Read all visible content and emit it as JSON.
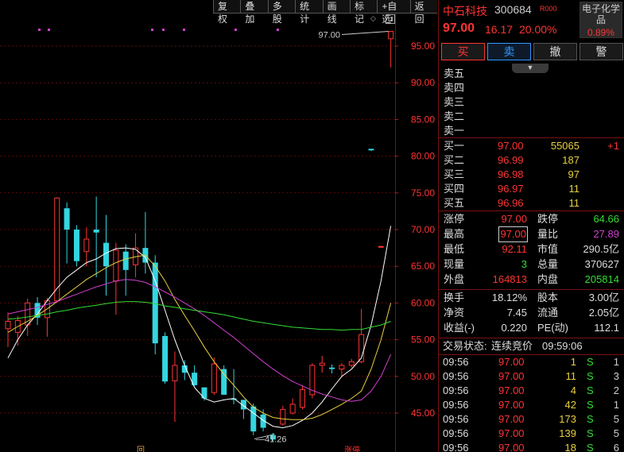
{
  "toolbar": [
    {
      "name": "fuquan-button",
      "label": "复权"
    },
    {
      "name": "overlay-button",
      "label": "叠加"
    },
    {
      "name": "multi-stock-button",
      "label": "多股"
    },
    {
      "name": "stats-button",
      "label": "统计"
    },
    {
      "name": "draw-line-button",
      "label": "画线"
    },
    {
      "name": "mark-button",
      "label": "标记"
    },
    {
      "name": "add-watchlist-button",
      "label": "+自选"
    },
    {
      "name": "back-button",
      "label": "返回"
    }
  ],
  "price_axis": [
    "95.00",
    "90.00",
    "85.00",
    "80.00",
    "75.00",
    "70.00",
    "65.00",
    "60.00",
    "55.00",
    "50.00",
    "45.00"
  ],
  "chart_data": {
    "type": "candlestick",
    "title": "",
    "ylim": [
      40.5,
      98.5
    ],
    "y_ticks": [
      95,
      90,
      85,
      80,
      75,
      70,
      65,
      60,
      55,
      50,
      45
    ],
    "annotations": {
      "high_label": "97.00",
      "low_label": "41.26",
      "bottom_left": "回",
      "bottom_right": "涨停"
    },
    "candles": [
      {
        "o": 56.5,
        "h": 58.7,
        "l": 54.0,
        "c": 57.5
      },
      {
        "o": 56.0,
        "h": 58.2,
        "l": 54.2,
        "c": 57.6
      },
      {
        "o": 57.0,
        "h": 60.6,
        "l": 55.5,
        "c": 60.0
      },
      {
        "o": 60.0,
        "h": 60.8,
        "l": 57.0,
        "c": 58.0
      },
      {
        "o": 58.0,
        "h": 60.7,
        "l": 55.4,
        "c": 60.3
      },
      {
        "o": 60.3,
        "h": 74.4,
        "l": 60.0,
        "c": 74.3
      },
      {
        "o": 72.9,
        "h": 73.7,
        "l": 65.4,
        "c": 70.0
      },
      {
        "o": 70.0,
        "h": 70.6,
        "l": 65.0,
        "c": 65.7
      },
      {
        "o": 67.0,
        "h": 70.3,
        "l": 65.0,
        "c": 68.7
      },
      {
        "o": 70.0,
        "h": 74.5,
        "l": 63.5,
        "c": 69.6
      },
      {
        "o": 68.2,
        "h": 72.0,
        "l": 61.0,
        "c": 65.0
      },
      {
        "o": 63.0,
        "h": 68.2,
        "l": 58.4,
        "c": 67.2
      },
      {
        "o": 67.0,
        "h": 68.0,
        "l": 61.0,
        "c": 64.5
      },
      {
        "o": 65.2,
        "h": 69.5,
        "l": 63.5,
        "c": 67.5
      },
      {
        "o": 67.5,
        "h": 72.4,
        "l": 64.0,
        "c": 65.5
      },
      {
        "o": 65.5,
        "h": 66.5,
        "l": 53.0,
        "c": 54.5
      },
      {
        "o": 55.5,
        "h": 56.0,
        "l": 49.0,
        "c": 49.3
      },
      {
        "o": 49.4,
        "h": 53.4,
        "l": 43.8,
        "c": 51.5
      },
      {
        "o": 51.5,
        "h": 52.2,
        "l": 49.5,
        "c": 50.5
      },
      {
        "o": 50.5,
        "h": 51.5,
        "l": 48.7,
        "c": 48.8
      },
      {
        "o": 48.5,
        "h": 48.5,
        "l": 46.7,
        "c": 47.0
      },
      {
        "o": 47.8,
        "h": 52.6,
        "l": 47.5,
        "c": 51.7
      },
      {
        "o": 51.0,
        "h": 51.5,
        "l": 47.5,
        "c": 47.5
      },
      {
        "o": 47.0,
        "h": 51.0,
        "l": 46.2,
        "c": 46.8
      },
      {
        "o": 46.8,
        "h": 46.8,
        "l": 44.2,
        "c": 45.5
      },
      {
        "o": 45.9,
        "h": 46.3,
        "l": 42.0,
        "c": 42.5
      },
      {
        "o": 44.8,
        "h": 45.5,
        "l": 42.5,
        "c": 43.0
      },
      {
        "o": 42.0,
        "h": 42.3,
        "l": 41.2,
        "c": 41.4
      },
      {
        "o": 43.5,
        "h": 46.0,
        "l": 43.3,
        "c": 45.5
      },
      {
        "o": 45.0,
        "h": 47.0,
        "l": 44.8,
        "c": 46.2
      },
      {
        "o": 45.8,
        "h": 48.8,
        "l": 45.5,
        "c": 48.2
      },
      {
        "o": 47.5,
        "h": 51.8,
        "l": 47.0,
        "c": 51.5
      },
      {
        "o": 51.5,
        "h": 52.8,
        "l": 50.5,
        "c": 51.8
      },
      {
        "o": 51.2,
        "h": 51.6,
        "l": 50.4,
        "c": 51.0
      },
      {
        "o": 51.0,
        "h": 51.8,
        "l": 50.0,
        "c": 51.5
      },
      {
        "o": 51.5,
        "h": 52.4,
        "l": 51.2,
        "c": 52.0
      },
      {
        "o": 52.0,
        "h": 59.2,
        "l": 51.8,
        "c": 55.7
      },
      {
        "o": 81.0,
        "h": 81.0,
        "l": 80.7,
        "c": 80.8
      },
      {
        "o": 67.6,
        "h": 67.8,
        "l": 67.5,
        "c": 67.7
      },
      {
        "o": 96.0,
        "h": 97.0,
        "l": 92.1,
        "c": 97.0
      }
    ],
    "ma_lines": [
      {
        "color": "#ffffff",
        "values": [
          52.5,
          55.0,
          57.0,
          58.5,
          60.3,
          62.0,
          63.5,
          64.5,
          65.5,
          66.0,
          66.8,
          67.4,
          67.5,
          67.3,
          66.2,
          63.0,
          59.0,
          55.0,
          51.5,
          48.5,
          47.0,
          46.5,
          46.8,
          47.0,
          46.0,
          45.0,
          44.0,
          43.2,
          43.0,
          43.3,
          44.0,
          45.0,
          46.5,
          48.3,
          50.0,
          51.0,
          52.5,
          57.0,
          63.0,
          70.5
        ]
      },
      {
        "color": "#e8d040",
        "values": [
          56.0,
          56.8,
          57.5,
          58.3,
          59.2,
          60.2,
          61.2,
          62.2,
          63.2,
          64.0,
          64.8,
          65.5,
          66.0,
          66.3,
          66.5,
          65.0,
          63.0,
          60.5,
          58.3,
          56.2,
          54.0,
          52.0,
          50.3,
          48.8,
          47.2,
          45.8,
          45.0,
          44.4,
          44.2,
          44.1,
          44.1,
          44.3,
          44.8,
          45.5,
          46.2,
          47.0,
          48.0,
          51.0,
          55.0,
          60.0
        ]
      },
      {
        "color": "#d040d0",
        "values": [
          58.5,
          58.8,
          59.1,
          59.4,
          59.8,
          60.2,
          60.7,
          61.2,
          61.7,
          62.2,
          62.6,
          63.0,
          63.2,
          63.1,
          62.8,
          62.2,
          61.5,
          60.8,
          60.0,
          59.2,
          58.3,
          57.3,
          56.3,
          55.3,
          54.2,
          53.1,
          52.0,
          51.0,
          50.1,
          49.3,
          48.7,
          48.1,
          47.6,
          47.2,
          46.8,
          46.6,
          46.8,
          48.0,
          50.0,
          53.0
        ]
      },
      {
        "color": "#33dd33",
        "values": [
          57.8,
          57.9,
          58.1,
          58.3,
          58.5,
          58.8,
          59.0,
          59.3,
          59.5,
          59.7,
          59.9,
          60.1,
          60.2,
          60.2,
          60.1,
          59.9,
          59.6,
          59.4,
          59.2,
          59.0,
          58.8,
          58.6,
          58.4,
          58.1,
          57.8,
          57.5,
          57.3,
          57.1,
          56.9,
          56.7,
          56.6,
          56.5,
          56.4,
          56.4,
          56.3,
          56.4,
          56.4,
          56.7,
          57.0,
          57.5
        ]
      }
    ]
  },
  "stock": {
    "name": "中石科技",
    "code": "300684",
    "tag": "R000",
    "price": "97.00",
    "change": "16.17",
    "change_pct": "20.00%",
    "sector_name": "电子化学品",
    "sector_pct": "0.89%"
  },
  "trade_buttons": [
    {
      "name": "buy-button",
      "label": "买",
      "cls": "buy"
    },
    {
      "name": "sell-button",
      "label": "卖",
      "cls": "sell"
    },
    {
      "name": "cancel-order-button",
      "label": "撤",
      "cls": "cancel"
    },
    {
      "name": "alert-button",
      "label": "警",
      "cls": "alert"
    }
  ],
  "sell_levels": [
    {
      "label": "卖五"
    },
    {
      "label": "卖四"
    },
    {
      "label": "卖三"
    },
    {
      "label": "卖二"
    },
    {
      "label": "卖一"
    }
  ],
  "buy_levels": [
    {
      "label": "买一",
      "price": "97.00",
      "volume": "55065",
      "delta": "+1"
    },
    {
      "label": "买二",
      "price": "96.99",
      "volume": "187",
      "delta": ""
    },
    {
      "label": "买三",
      "price": "96.98",
      "volume": "97",
      "delta": ""
    },
    {
      "label": "买四",
      "price": "96.97",
      "volume": "11",
      "delta": ""
    },
    {
      "label": "买五",
      "price": "96.96",
      "volume": "11",
      "delta": ""
    }
  ],
  "stats_a": [
    {
      "l1": "涨停",
      "v1": "97.00",
      "c1": "red",
      "l2": "跌停",
      "v2": "64.66",
      "c2": "green"
    },
    {
      "l1": "最高",
      "v1": "97.00",
      "c1": "red",
      "l2": "量比",
      "v2": "27.89",
      "c2": "magenta",
      "boxed": true
    },
    {
      "l1": "最低",
      "v1": "92.11",
      "c1": "red",
      "l2": "市值",
      "v2": "290.5亿",
      "c2": "white"
    },
    {
      "l1": "现量",
      "v1": "3",
      "c1": "green",
      "l2": "总量",
      "v2": "370627",
      "c2": "white"
    },
    {
      "l1": "外盘",
      "v1": "164813",
      "c1": "red",
      "l2": "内盘",
      "v2": "205814",
      "c2": "green"
    }
  ],
  "stats_b": [
    {
      "l1": "换手",
      "v1": "18.12%",
      "l2": "股本",
      "v2": "3.00亿"
    },
    {
      "l1": "净资",
      "v1": "7.45",
      "l2": "流通",
      "v2": "2.05亿"
    },
    {
      "l1": "收益(-)",
      "v1": "0.220",
      "l2": "PE(动)",
      "v2": "112.1"
    }
  ],
  "trade_status": {
    "label": "交易状态:",
    "value": "连续竞价",
    "time": "09:59:06"
  },
  "ticks": [
    {
      "time": "09:56",
      "price": "97.00",
      "vol": "1",
      "side": "S",
      "n": "1"
    },
    {
      "time": "09:56",
      "price": "97.00",
      "vol": "11",
      "side": "S",
      "n": "3"
    },
    {
      "time": "09:56",
      "price": "97.00",
      "vol": "4",
      "side": "S",
      "n": "2"
    },
    {
      "time": "09:56",
      "price": "97.00",
      "vol": "42",
      "side": "S",
      "n": "1"
    },
    {
      "time": "09:56",
      "price": "97.00",
      "vol": "173",
      "side": "S",
      "n": "5"
    },
    {
      "time": "09:56",
      "price": "97.00",
      "vol": "139",
      "side": "S",
      "n": "5"
    },
    {
      "time": "09:56",
      "price": "97.00",
      "vol": "18",
      "side": "S",
      "n": "6"
    }
  ]
}
